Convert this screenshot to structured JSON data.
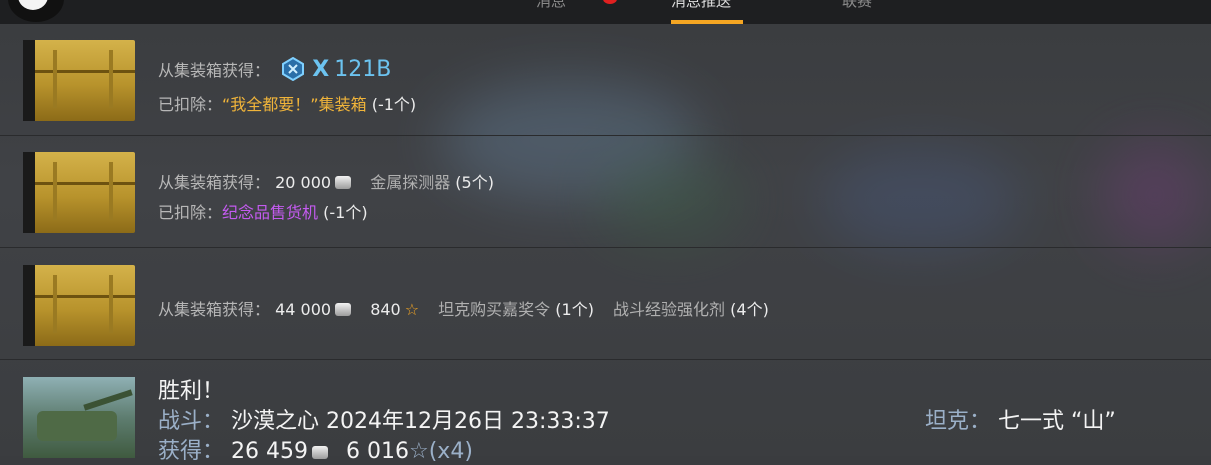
{
  "tabs": [
    "消息",
    "消息推送",
    "联赛"
  ],
  "rows": [
    {
      "obtained_label": "从集装箱获得：",
      "reward_prefix": "X",
      "reward_value": "121B",
      "deducted_label": "已扣除：",
      "deducted_item": "“我全都要！”集装箱",
      "deducted_count": "(-1个)"
    },
    {
      "obtained_label": "从集装箱获得：",
      "credits": "20 000",
      "item_name": "金属探测器",
      "item_count": "(5个)",
      "deducted_label": "已扣除：",
      "deducted_item": "纪念品售货机",
      "deducted_count": "(-1个)"
    },
    {
      "obtained_label": "从集装箱获得：",
      "credits": "44 000",
      "xp": "840",
      "item1_name": "坦克购买嘉奖令",
      "item1_count": "(1个)",
      "item2_name": "战斗经验强化剂",
      "item2_count": "(4个)"
    },
    {
      "title": "胜利！",
      "battle_label": "战斗：",
      "battle_value": "沙漠之心 2024年12月26日 23:33:37",
      "tank_label": "坦克：",
      "tank_value": "七一式 “山”",
      "earned_label": "获得：",
      "earned_credits": "26 459",
      "earned_xp": "6 016",
      "earned_mult": "(x4)"
    }
  ],
  "colors": {
    "gold": "#f0b43a",
    "purple": "#c45bf0",
    "blue": "#6cc3f0",
    "accent": "#f5a623"
  },
  "icons": [
    "chest-icon",
    "tank-icon",
    "credits-icon",
    "star-icon",
    "elite-badge-icon"
  ]
}
